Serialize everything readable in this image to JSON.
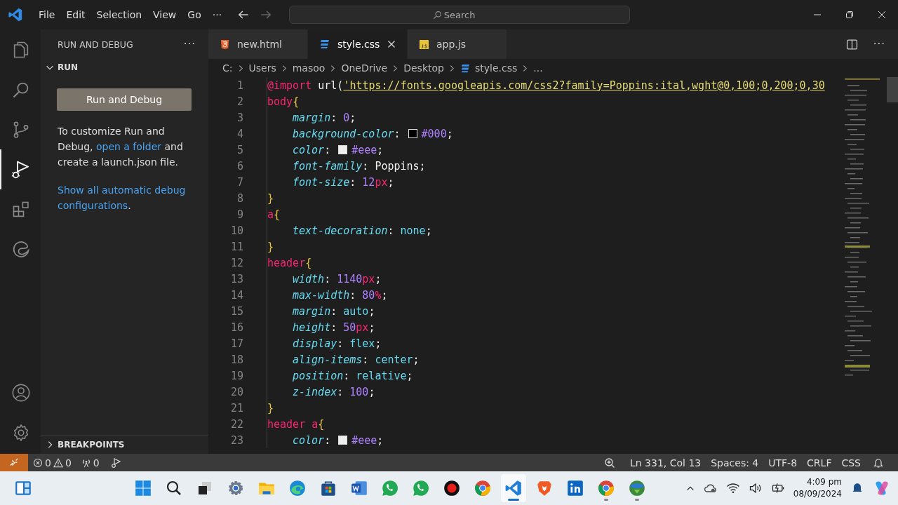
{
  "title_bar": {
    "menus": [
      "File",
      "Edit",
      "Selection",
      "View",
      "Go"
    ],
    "more": "···",
    "back_disabled": false,
    "forward_disabled": true,
    "search": {
      "placeholder": "Search"
    }
  },
  "activity_bar": [
    {
      "kind": "explorer",
      "selected": false
    },
    {
      "kind": "search",
      "selected": false
    },
    {
      "kind": "scm",
      "selected": false
    },
    {
      "kind": "debug",
      "selected": true
    },
    {
      "kind": "extensions",
      "selected": false
    },
    {
      "kind": "edge",
      "selected": false
    }
  ],
  "activity_bottom": [
    {
      "kind": "account"
    },
    {
      "kind": "settings"
    }
  ],
  "sidebar": {
    "title": "RUN AND DEBUG",
    "more": "···",
    "section": "RUN",
    "expanded": true,
    "button": "Run and Debug",
    "text_before": "To customize Run and Debug,",
    "link": "open a folder",
    "text_after": "and create a launch.json file.",
    "link2": "Show all automatic debug configurations",
    "link2_after": ".",
    "footer": "BREAKPOINTS",
    "footer_expanded": false
  },
  "tabs": [
    {
      "label": "new.html",
      "kind": "html",
      "selected": false
    },
    {
      "label": "style.css",
      "kind": "css",
      "selected": true
    },
    {
      "label": "app.js",
      "kind": "js",
      "selected": false
    }
  ],
  "editor_actions": {
    "more": "···"
  },
  "breadcrumb": [
    "C:",
    "Users",
    "masoo",
    "OneDrive",
    "Desktop",
    "style.css",
    "..."
  ],
  "code": [
    {
      "num": "1",
      "indented": false,
      "tokens": [
        {
          "kind": "at",
          "text": "@import"
        },
        {
          "kind": "plain",
          "text": " url("
        },
        {
          "kind": "str",
          "text": "'https://fonts.googleapis.com/css2?family=Poppins:ital,wght@0,100;0,200;0,30"
        }
      ]
    },
    {
      "num": "2",
      "indented": false,
      "tokens": [
        {
          "kind": "sel",
          "text": "body"
        },
        {
          "kind": "brace",
          "text": "{"
        }
      ]
    },
    {
      "num": "3",
      "indented": true,
      "tokens": [
        {
          "kind": "prop",
          "text": "margin"
        },
        {
          "kind": "plain",
          "text": ": "
        },
        {
          "kind": "num",
          "text": "0"
        },
        {
          "kind": "plain",
          "text": ";"
        }
      ]
    },
    {
      "num": "4",
      "indented": true,
      "tokens": [
        {
          "kind": "prop",
          "text": "background-color"
        },
        {
          "kind": "plain",
          "text": ": "
        },
        {
          "kind": "swatch",
          "color": "#000000"
        },
        {
          "kind": "num",
          "text": "#000"
        },
        {
          "kind": "plain",
          "text": ";"
        }
      ]
    },
    {
      "num": "5",
      "indented": true,
      "tokens": [
        {
          "kind": "prop",
          "text": "color"
        },
        {
          "kind": "plain",
          "text": ": "
        },
        {
          "kind": "swatch",
          "color": "#eeeeee"
        },
        {
          "kind": "num",
          "text": "#eee"
        },
        {
          "kind": "plain",
          "text": ";"
        }
      ]
    },
    {
      "num": "6",
      "indented": true,
      "tokens": [
        {
          "kind": "prop",
          "text": "font-family"
        },
        {
          "kind": "plain",
          "text": ": Poppins;"
        }
      ]
    },
    {
      "num": "7",
      "indented": true,
      "tokens": [
        {
          "kind": "prop",
          "text": "font-size"
        },
        {
          "kind": "plain",
          "text": ": "
        },
        {
          "kind": "num",
          "text": "12"
        },
        {
          "kind": "unit",
          "text": "px"
        },
        {
          "kind": "plain",
          "text": ";"
        }
      ]
    },
    {
      "num": "8",
      "indented": false,
      "tokens": [
        {
          "kind": "brace",
          "text": "}"
        }
      ]
    },
    {
      "num": "9",
      "indented": false,
      "tokens": [
        {
          "kind": "sel",
          "text": "a"
        },
        {
          "kind": "brace",
          "text": "{"
        }
      ]
    },
    {
      "num": "10",
      "indented": true,
      "tokens": [
        {
          "kind": "prop",
          "text": "text-decoration"
        },
        {
          "kind": "plain",
          "text": ": "
        },
        {
          "kind": "val",
          "text": "none"
        },
        {
          "kind": "plain",
          "text": ";"
        }
      ]
    },
    {
      "num": "11",
      "indented": false,
      "tokens": [
        {
          "kind": "brace",
          "text": "}"
        }
      ]
    },
    {
      "num": "12",
      "indented": false,
      "tokens": [
        {
          "kind": "sel",
          "text": "header"
        },
        {
          "kind": "brace",
          "text": "{"
        }
      ]
    },
    {
      "num": "13",
      "indented": true,
      "tokens": [
        {
          "kind": "prop",
          "text": "width"
        },
        {
          "kind": "plain",
          "text": ": "
        },
        {
          "kind": "num",
          "text": "1140"
        },
        {
          "kind": "unit",
          "text": "px"
        },
        {
          "kind": "plain",
          "text": ";"
        }
      ]
    },
    {
      "num": "14",
      "indented": true,
      "tokens": [
        {
          "kind": "prop",
          "text": "max-width"
        },
        {
          "kind": "plain",
          "text": ": "
        },
        {
          "kind": "num",
          "text": "80"
        },
        {
          "kind": "unit",
          "text": "%"
        },
        {
          "kind": "plain",
          "text": ";"
        }
      ]
    },
    {
      "num": "15",
      "indented": true,
      "tokens": [
        {
          "kind": "prop",
          "text": "margin"
        },
        {
          "kind": "plain",
          "text": ": "
        },
        {
          "kind": "val",
          "text": "auto"
        },
        {
          "kind": "plain",
          "text": ";"
        }
      ]
    },
    {
      "num": "16",
      "indented": true,
      "tokens": [
        {
          "kind": "prop",
          "text": "height"
        },
        {
          "kind": "plain",
          "text": ": "
        },
        {
          "kind": "num",
          "text": "50"
        },
        {
          "kind": "unit",
          "text": "px"
        },
        {
          "kind": "plain",
          "text": ";"
        }
      ]
    },
    {
      "num": "17",
      "indented": true,
      "tokens": [
        {
          "kind": "prop",
          "text": "display"
        },
        {
          "kind": "plain",
          "text": ": "
        },
        {
          "kind": "val",
          "text": "flex"
        },
        {
          "kind": "plain",
          "text": ";"
        }
      ]
    },
    {
      "num": "18",
      "indented": true,
      "tokens": [
        {
          "kind": "prop",
          "text": "align-items"
        },
        {
          "kind": "plain",
          "text": ": "
        },
        {
          "kind": "val",
          "text": "center"
        },
        {
          "kind": "plain",
          "text": ";"
        }
      ]
    },
    {
      "num": "19",
      "indented": true,
      "tokens": [
        {
          "kind": "prop",
          "text": "position"
        },
        {
          "kind": "plain",
          "text": ": "
        },
        {
          "kind": "val",
          "text": "relative"
        },
        {
          "kind": "plain",
          "text": ";"
        }
      ]
    },
    {
      "num": "20",
      "indented": true,
      "tokens": [
        {
          "kind": "prop",
          "text": "z-index"
        },
        {
          "kind": "plain",
          "text": ": "
        },
        {
          "kind": "num",
          "text": "100"
        },
        {
          "kind": "plain",
          "text": ";"
        }
      ]
    },
    {
      "num": "21",
      "indented": false,
      "tokens": [
        {
          "kind": "brace",
          "text": "}"
        }
      ]
    },
    {
      "num": "22",
      "indented": false,
      "tokens": [
        {
          "kind": "sel",
          "text": "header a"
        },
        {
          "kind": "brace",
          "text": "{"
        }
      ]
    },
    {
      "num": "23",
      "indented": true,
      "tokens": [
        {
          "kind": "prop",
          "text": "color"
        },
        {
          "kind": "plain",
          "text": ": "
        },
        {
          "kind": "swatch",
          "color": "#eeeeee"
        },
        {
          "kind": "num",
          "text": "#eee"
        },
        {
          "kind": "plain",
          "text": ";"
        }
      ]
    }
  ],
  "status_bar": {
    "errors": "0",
    "warnings": "0",
    "ports": "0",
    "position": "Ln 331, Col 13",
    "spaces": "Spaces: 4",
    "encoding": "UTF-8",
    "eol": "CRLF",
    "language": "CSS"
  },
  "taskbar": {
    "apps": [
      {
        "kind": "start",
        "running": false,
        "selected": false
      },
      {
        "kind": "search",
        "running": false,
        "selected": false
      },
      {
        "kind": "taskview",
        "running": false,
        "selected": false
      },
      {
        "kind": "settings",
        "running": false,
        "selected": false
      },
      {
        "kind": "folder",
        "running": false,
        "selected": false
      },
      {
        "kind": "edge",
        "running": false,
        "selected": false
      },
      {
        "kind": "store",
        "running": false,
        "selected": false
      },
      {
        "kind": "word",
        "running": false,
        "selected": false
      },
      {
        "kind": "whatsapp",
        "running": false,
        "selected": false
      },
      {
        "kind": "whatsapp",
        "running": false,
        "selected": false
      },
      {
        "kind": "record",
        "running": false,
        "selected": false
      },
      {
        "kind": "chrome",
        "running": false,
        "selected": false
      },
      {
        "kind": "vscode",
        "running": true,
        "selected": true
      },
      {
        "kind": "brave",
        "running": false,
        "selected": false
      },
      {
        "kind": "linkedin",
        "running": false,
        "selected": false
      },
      {
        "kind": "chrome",
        "running": true,
        "selected": false
      },
      {
        "kind": "idm",
        "running": true,
        "selected": false
      }
    ],
    "time": "4:09 pm",
    "date": "08/09/2024"
  }
}
